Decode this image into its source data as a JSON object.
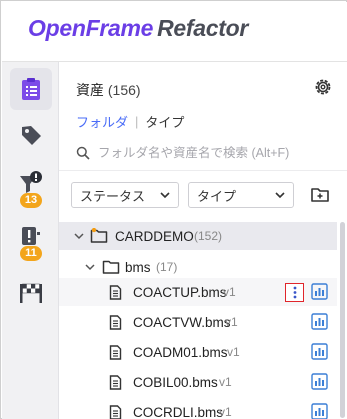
{
  "app": {
    "brand_primary": "OpenFrame",
    "brand_secondary": "Refactor",
    "colors": {
      "brand": "#6b3ee6",
      "accent": "#4a6cf7",
      "badge": "#f3a51b",
      "highlight": "#e0252b",
      "folder_dot": "#f39c12"
    }
  },
  "rail": {
    "items": [
      {
        "icon": "clipboard-icon",
        "active": true
      },
      {
        "icon": "tag-icon",
        "active": false
      },
      {
        "icon": "filter-alert-icon",
        "badge": "13"
      },
      {
        "icon": "warning-list-icon",
        "badge": "11"
      },
      {
        "icon": "finish-flag-icon"
      }
    ]
  },
  "panel": {
    "title": "資産",
    "count": "(156)",
    "view_tabs": {
      "folder": "フォルダ",
      "separator": "|",
      "type": "タイプ"
    },
    "search_placeholder": "フォルダ名や資産名で検索 (Alt+F)",
    "filters": {
      "status": "ステータス",
      "type": "タイプ"
    }
  },
  "tree": {
    "root": {
      "name": "CARDDEMO",
      "count": "(152)"
    },
    "folder": {
      "name": "bms",
      "count": "(17)"
    },
    "files": [
      {
        "name": "COACTUP.bms",
        "version": "v1"
      },
      {
        "name": "COACTVW.bms",
        "version": "v1"
      },
      {
        "name": "COADM01.bms",
        "version": "v1"
      },
      {
        "name": "COBIL00.bms",
        "version": "v1"
      },
      {
        "name": "COCRDLI.bms",
        "version": "v1"
      }
    ]
  }
}
